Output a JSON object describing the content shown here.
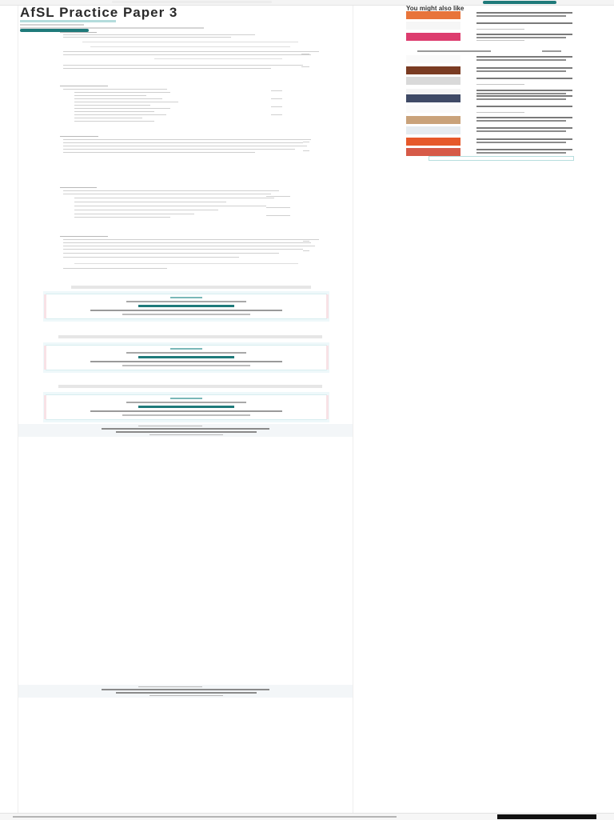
{
  "document": {
    "title": "AfSL Practice Paper 3"
  },
  "sidebar": {
    "heading": "You might also like",
    "thumb_colors": [
      "#e8743a",
      "#f6f6f6",
      "#dd3d6f",
      "#fafafa",
      "#7a3b22",
      "#d9d9d9",
      "#f4f4f4",
      "#3f4a66",
      "#fafafa",
      "#c9a27a",
      "#e5ebf0",
      "#e6582a",
      "#d65a48"
    ]
  },
  "colors": {
    "accent": "#1f7a7a",
    "preview_border": "#d8eef0"
  }
}
